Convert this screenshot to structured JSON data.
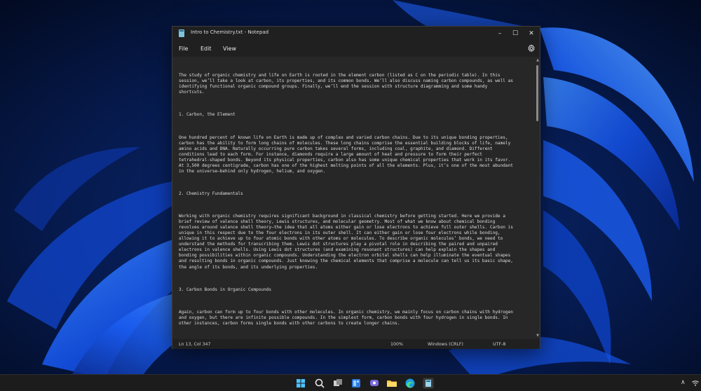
{
  "theme": {
    "accent": "#1f5bff",
    "window_bg": "#272727",
    "titlebar_bg": "#202020",
    "text": "#dedede"
  },
  "window": {
    "title": "Intro to Chemistry.txt - Notepad",
    "icon": "notepad-icon",
    "controls": {
      "minimize": "–",
      "maximize": "☐",
      "close": "✕"
    }
  },
  "menu": {
    "file": "File",
    "edit": "Edit",
    "view": "View",
    "settings_icon": "gear-icon"
  },
  "document": {
    "paragraphs": [
      "The study of organic chemistry and life on Earth is rooted in the element carbon (listed as C on the periodic table). In this\nsession, we’ll take a look at carbon, its properties, and its common bonds. We’ll also discuss naming carbon compounds, as well as\nidentifying functional organic compound groups. Finally, we’ll end the session with structure diagramming and some handy\nshortcuts.",
      "1. Carbon, the Element",
      "One hundred percent of known life on Earth is made up of complex and varied carbon chains. Due to its unique bonding properties,\ncarbon has the ability to form long chains of molecules. These long chains comprise the essential building blocks of life, namely\namino acids and DNA. Naturally occurring pure carbon takes several forms, including coal, graphite, and diamond. Different\nconditions lead to each form. For instance, diamonds require a large amount of heat and pressure to form their perfect\ntetrahedral-shaped bonds. Beyond its physical properties, carbon also has some unique chemical properties that work in its favor.\nAt 3,500 degrees centigrade, carbon has one of the highest melting points of all the elements. Plus, it’s one of the most abundant\nin the universe—behind only hydrogen, helium, and oxygen.",
      "2. Chemistry Fundamentals",
      "Working with organic chemistry requires significant background in classical chemistry before getting started. Here we provide a\nbrief review of valence shell theory, Lewis structures, and molecular geometry. Most of what we know about chemical bonding\nrevolves around valence shell theory—the idea that all atoms either gain or lose electrons to achieve full outer shells. Carbon is\nunique in this respect due to the four electrons in its outer shell. It can either gain or lose four electrons while bonding,\nallowing it to achieve up to four atomic bonds with other atoms or molecules. To describe organic molecules’ bonds, we need to\nunderstand the methods for transcribing them. Lewis dot structures play a pivotal role in describing the paired and unpaired\nelectrons in valence shells. Using Lewis dot structures (and examining resonant structures) can help explain the shapes and\nbonding possibilities within organic compounds. Understanding the electron orbital shells can help illuminate the eventual shapes\nand resulting bonds in organic compounds. Just knowing the chemical elements that comprise a molecule can tell us its basic shape,\nthe angle of its bonds, and its underlying properties.",
      "3. Carbon Bonds in Organic Compounds",
      "Again, carbon can form up to four bonds with other molecules. In organic chemistry, we mainly focus on carbon chains with hydrogen\nand oxygen, but there are infinite possible compounds. In the simplest form, carbon bonds with four hydrogen in single bonds. In\nother instances, carbon forms single bonds with other carbons to create longer chains."
    ]
  },
  "statusbar": {
    "position": "Ln 13, Col 347",
    "zoom": "100%",
    "line_ending": "Windows (CRLF)",
    "encoding": "UTF-8"
  },
  "taskbar": {
    "icons": [
      "windows-start-icon",
      "search-icon",
      "task-view-icon",
      "widgets-icon",
      "chat-icon",
      "file-explorer-icon",
      "edge-icon",
      "store-icon",
      "notepad-icon"
    ],
    "tray": {
      "chevron": "∧"
    }
  }
}
